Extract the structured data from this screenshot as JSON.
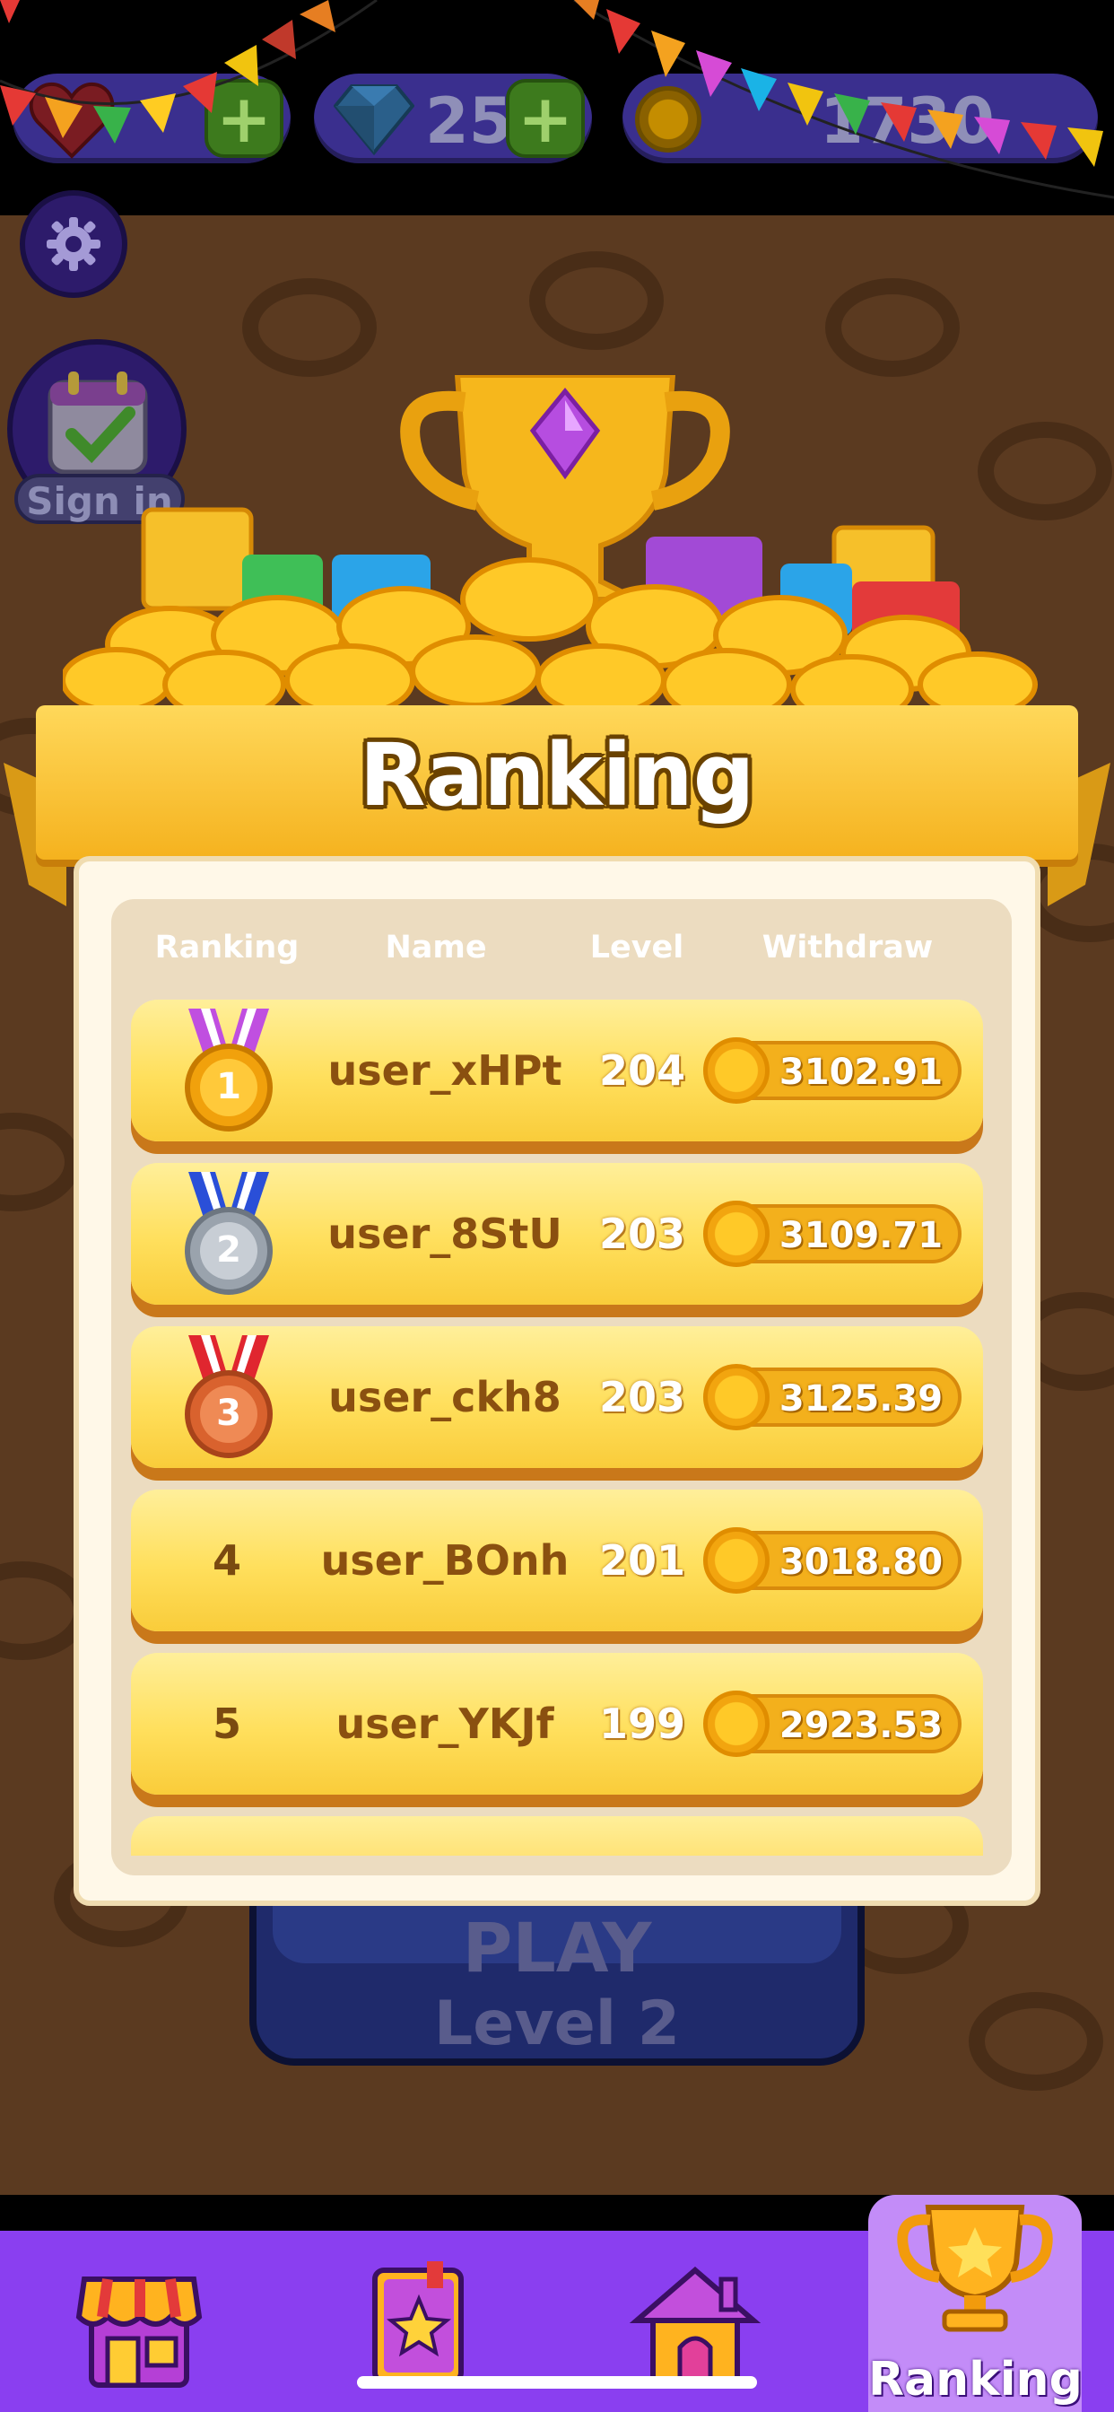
{
  "topbar": {
    "lives": "",
    "gems": "25",
    "coins": "1730",
    "plus_label": "+"
  },
  "sidebar": {
    "signin_label": "Sign in"
  },
  "play": {
    "label": "PLAY",
    "level": "Level 2"
  },
  "ranking": {
    "title": "Ranking",
    "columns": [
      "Ranking",
      "Name",
      "Level",
      "Withdraw"
    ],
    "rows": [
      {
        "rank": "1",
        "name": "user_xHPt",
        "level": "204",
        "withdraw": "3102.91"
      },
      {
        "rank": "2",
        "name": "user_8StU",
        "level": "203",
        "withdraw": "3109.71"
      },
      {
        "rank": "3",
        "name": "user_ckh8",
        "level": "203",
        "withdraw": "3125.39"
      },
      {
        "rank": "4",
        "name": "user_BOnh",
        "level": "201",
        "withdraw": "3018.80"
      },
      {
        "rank": "5",
        "name": "user_YKJf",
        "level": "199",
        "withdraw": "2923.53"
      }
    ]
  },
  "nav": {
    "items": [
      "shop",
      "collection",
      "home",
      "ranking"
    ],
    "active_label": "Ranking"
  },
  "colors": {
    "nav_bg": "#8a3ff0",
    "nav_active": "#c38cf8",
    "row_gold": "#ffdf5c",
    "board_brown": "#5b3a20"
  }
}
